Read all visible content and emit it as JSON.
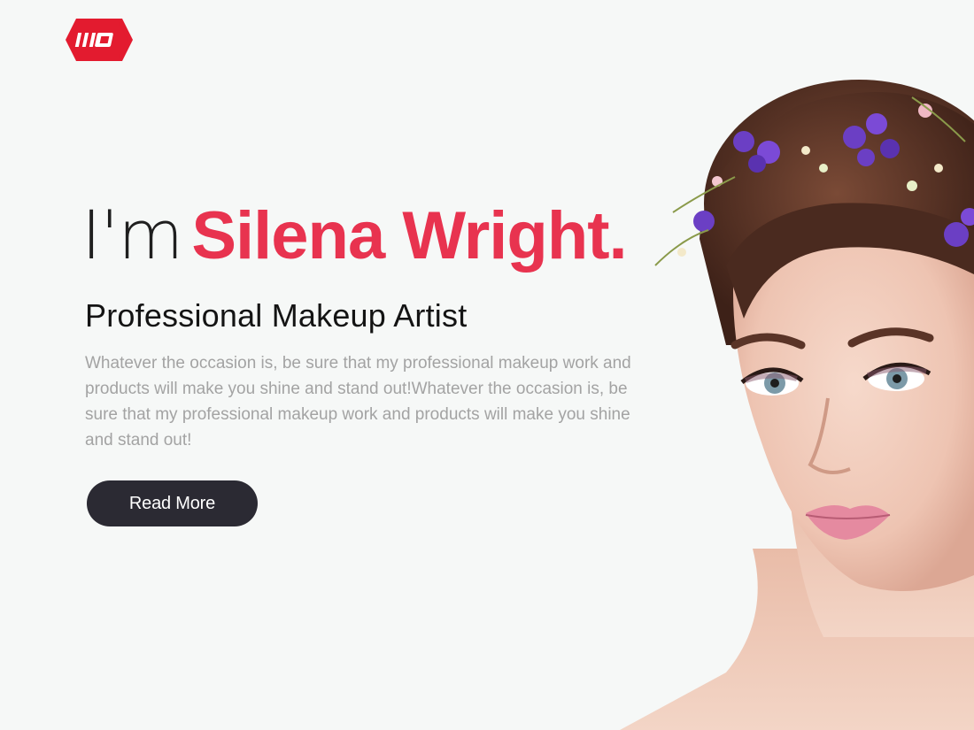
{
  "brand": {
    "logo_text": "MO",
    "logo_color": "#e31b2f"
  },
  "hero": {
    "prefix": "I'm",
    "name": "Silena Wright.",
    "subtitle": "Professional Makeup Artist",
    "description": "Whatever the occasion is, be sure that my professional makeup work and products will make you shine and stand out!Whatever the occasion is, be sure that my professional makeup work and products will make you shine and stand out!",
    "cta_label": "Read More"
  },
  "colors": {
    "accent": "#e8334f",
    "button_bg": "#2b2a33",
    "background": "#f6f8f7",
    "body_text": "#a3a3a3"
  }
}
